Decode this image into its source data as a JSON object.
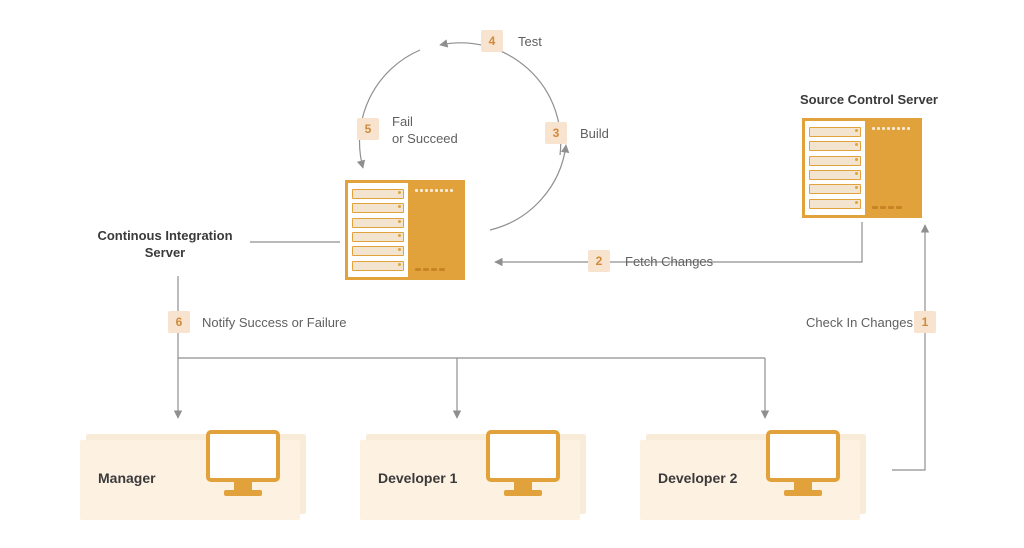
{
  "colors": {
    "accent": "#e2a23b",
    "badge_bg": "#f8e3cf",
    "text": "#4a4a4a"
  },
  "labels": {
    "ci_server": "Continous Integration\nServer",
    "sc_server": "Source Control Server"
  },
  "steps": {
    "s1": {
      "num": "1",
      "text": "Check In Changes"
    },
    "s2": {
      "num": "2",
      "text": "Fetch Changes"
    },
    "s3": {
      "num": "3",
      "text": "Build"
    },
    "s4": {
      "num": "4",
      "text": "Test"
    },
    "s5": {
      "num": "5",
      "text": "Fail\nor Succeed"
    },
    "s6": {
      "num": "6",
      "text": "Notify Success or Failure"
    }
  },
  "roles": {
    "manager": "Manager",
    "dev1": "Developer 1",
    "dev2": "Developer 2"
  }
}
